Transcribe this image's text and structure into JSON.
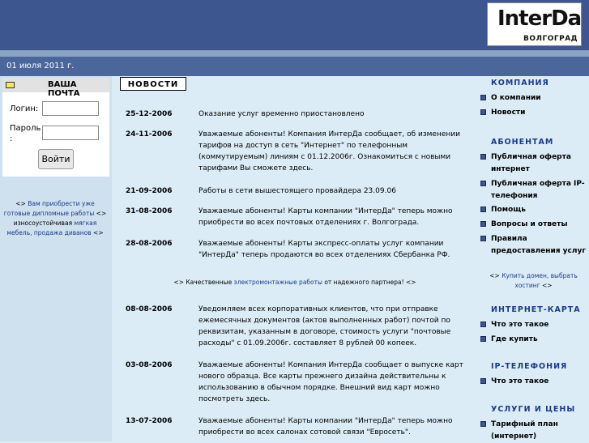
{
  "logo": {
    "name": "InterDa",
    "city": "ВОЛГОГРАД"
  },
  "date": "01 июля 2011 г.",
  "mailbox": {
    "title": "ВАША ПОЧТА",
    "login_label": "Логин:",
    "password_label": "Пароль :",
    "login_button": "Войти"
  },
  "left_ad": {
    "prefix": "<> ",
    "link1": "Вам приобрести уже готовые дипломные работы",
    "mid": " <> износоустойчивая ",
    "link2": "мягкая мебель, продажа диванов",
    "suffix": " <>"
  },
  "news_title": "НОВОСТИ",
  "news": [
    {
      "date": "25-12-2006",
      "text": "Оказание услуг временно приостановлено"
    },
    {
      "date": "24-11-2006",
      "text": "Уважаемые абоненты! Компания ИнтерДа сообщает, об изменении тарифов на доступ в сеть \"Интернет\" по телефонным (коммутируемым) линиям с 01.12.2006г. Ознакомиться с новыми тарифами Вы сможете здесь."
    },
    {
      "date": "21-09-2006",
      "text": "Работы в сети вышестоящего провайдера 23.09.06"
    },
    {
      "date": "31-08-2006",
      "text": "Уважаемые абоненты! Карты компании \"ИнтерДа\" теперь можно приобрести во всех почтовых отделениях г. Волгограда."
    },
    {
      "date": "28-08-2006",
      "text": "Уважаемые абоненты! Карты экспресс-оплаты услуг компании \"ИнтерДа\" теперь продаются во всех отделениях Сбербанка РФ."
    },
    {
      "date": "08-08-2006",
      "text": "Уведомляем всех корпоративных клиентов, что при отправке ежемесячных документов (актов выполненных работ) почтой по реквизитам, указанным в договоре, стоимость услуги \"почтовые расходы\" с 01.09.2006г. составляет 8 рублей 00 копеек."
    },
    {
      "date": "03-08-2006",
      "text": "Уважаемые абоненты! Компания ИнтерДа сообщает о выпуске карт нового образца. Все карты прежнего дизайна действительны к использованию в обычном порядке. Внешний вид карт можно посмотреть здесь."
    },
    {
      "date": "13-07-2006",
      "text": "Уважаемые абоненты! Карты компании \"ИнтерДа\" теперь можно приобрести во всех салонах сотовой связи \"Евросеть\"."
    }
  ],
  "mid_ad": {
    "prefix": "<> Качественные ",
    "link": "электромонтажные работы",
    "suffix": " от надежного партнера! <>"
  },
  "right": {
    "company": {
      "title": "КОМПАНИЯ",
      "items": [
        "О компании",
        "Новости"
      ]
    },
    "subscribers": {
      "title": "АБОНЕНТАМ",
      "items": [
        "Публичная оферта интернет",
        "Публичная оферта IP-телефония",
        "Помощь",
        "Вопросы и ответы",
        "Правила предоставления услуг"
      ]
    },
    "ad": {
      "prefix": "<> ",
      "link": "Купить домен, выбрать хостинг",
      "suffix": " <>"
    },
    "map": {
      "title": "ИНТЕРНЕТ-КАРТА",
      "items": [
        "Что это такое",
        "Где купить"
      ]
    },
    "ip": {
      "title": "IP-ТЕЛЕФОНИЯ",
      "items": [
        "Что это такое"
      ]
    },
    "prices": {
      "title": "УСЛУГИ И ЦЕНЫ",
      "items": [
        "Тарифный план (интернет)"
      ]
    }
  }
}
